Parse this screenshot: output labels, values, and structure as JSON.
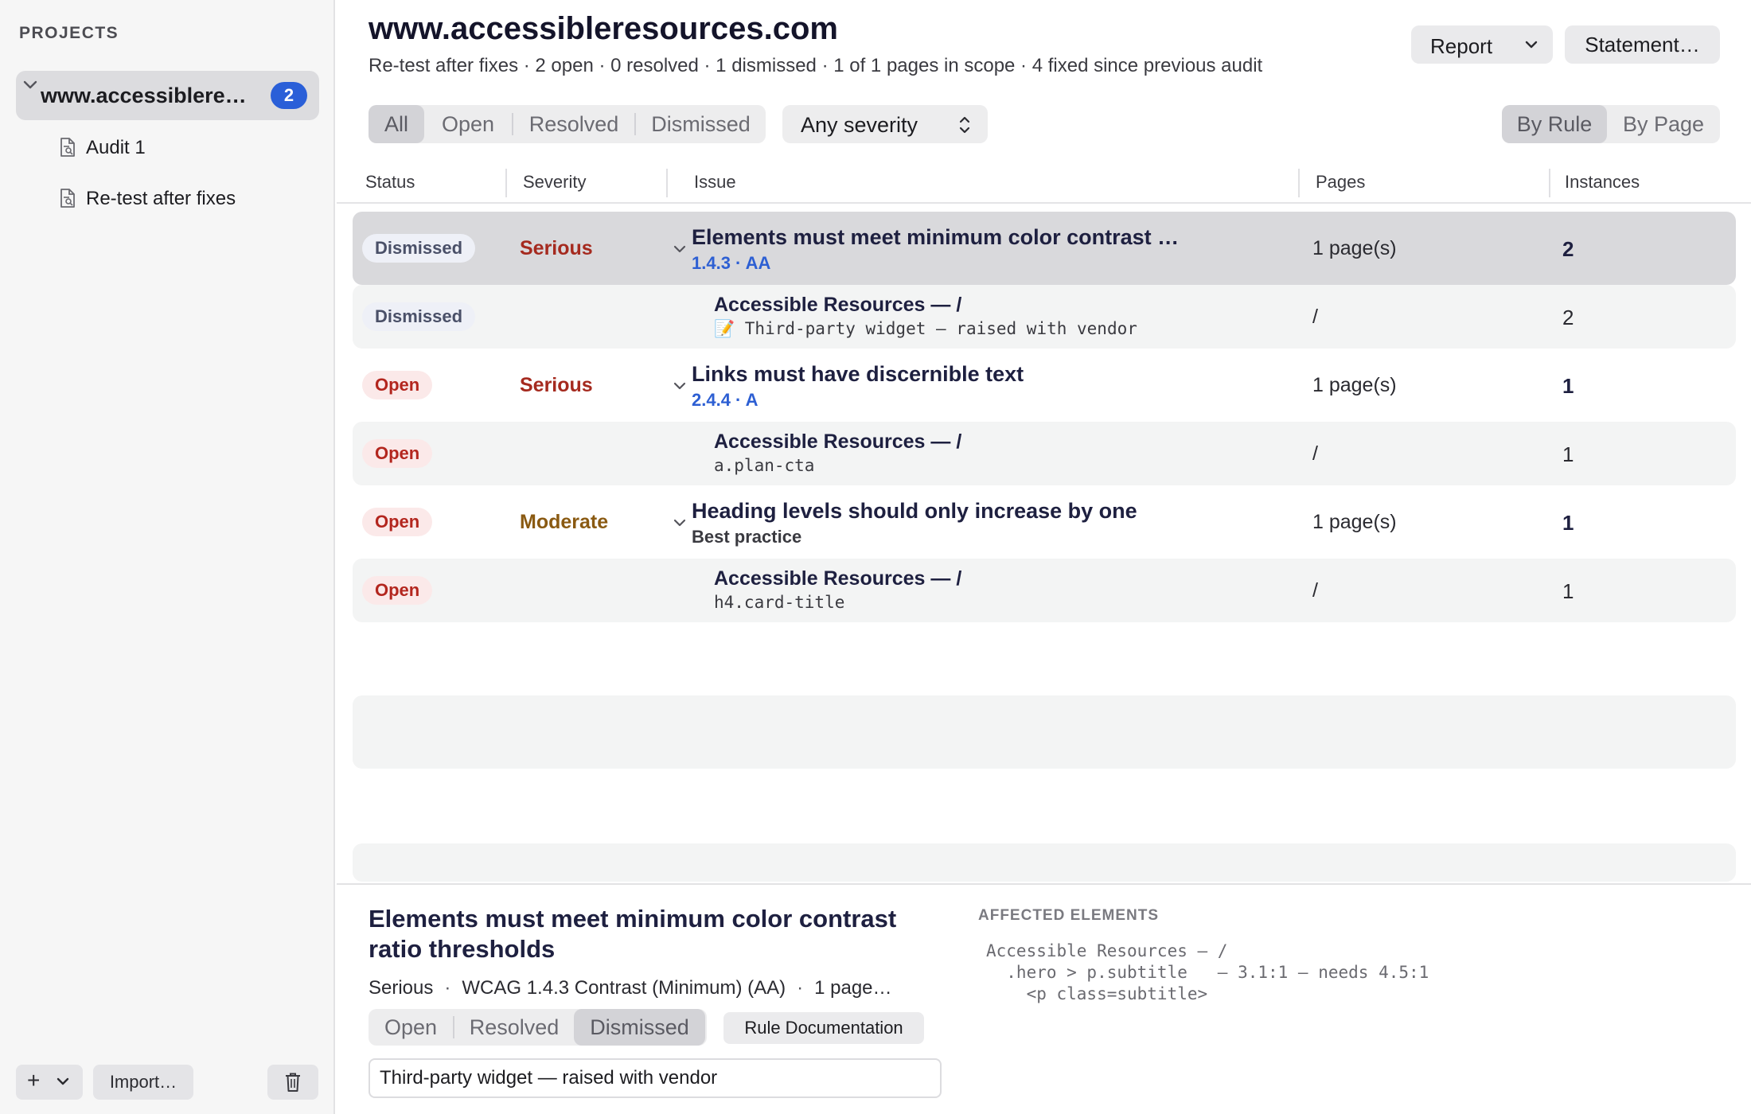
{
  "sidebar": {
    "heading": "PROJECTS",
    "project": {
      "name": "www.accessiblere…",
      "badge": "2"
    },
    "audits": [
      {
        "label": "Audit 1"
      },
      {
        "label": "Re-test after fixes"
      }
    ],
    "footer": {
      "add_label": "+",
      "import_label": "Import…"
    }
  },
  "header": {
    "title": "www.accessibleresources.com",
    "subtitle": "Re-test after fixes · 2 open · 0 resolved · 1 dismissed · 1 of 1 pages in scope · 4 fixed since previous audit",
    "report_label": "Report",
    "statement_label": "Statement…"
  },
  "filters": {
    "status": [
      {
        "label": "All",
        "active": true
      },
      {
        "label": "Open",
        "active": false
      },
      {
        "label": "Resolved",
        "active": false
      },
      {
        "label": "Dismissed",
        "active": false
      }
    ],
    "severity_selected": "Any severity",
    "view": [
      {
        "label": "By Rule",
        "active": true
      },
      {
        "label": "By Page",
        "active": false
      }
    ]
  },
  "table": {
    "columns": [
      "Status",
      "Severity",
      "Issue",
      "Pages",
      "Instances"
    ],
    "rows": [
      {
        "status": "Dismissed",
        "severity": "Serious",
        "title": "Elements must meet minimum color contrast ratio thresholds",
        "sub": "1.4.3 · AA",
        "pages": "1 page(s)",
        "instances": "2",
        "child": {
          "status": "Dismissed",
          "title": "Accessible Resources — /",
          "sub": "📝 Third‑party widget — raised with vendor",
          "pages": "/",
          "instances": "2"
        }
      },
      {
        "status": "Open",
        "severity": "Serious",
        "title": "Links must have discernible text",
        "sub": "2.4.4 · A",
        "pages": "1 page(s)",
        "instances": "1",
        "child": {
          "status": "Open",
          "title": "Accessible Resources — /",
          "sub": "a.plan-cta",
          "pages": "/",
          "instances": "1"
        }
      },
      {
        "status": "Open",
        "severity": "Moderate",
        "title": "Heading levels should only increase by one",
        "sub": "Best practice",
        "pages": "1 page(s)",
        "instances": "1",
        "child": {
          "status": "Open",
          "title": "Accessible Resources — /",
          "sub": "h4.card-title",
          "pages": "/",
          "instances": "1"
        }
      }
    ]
  },
  "detail": {
    "title": "Elements must meet minimum color contrast ratio thresholds",
    "severity": "Serious",
    "wcag": "WCAG 1.4.3 Contrast (Minimum) (AA)",
    "pages": "1 page…",
    "status_options": [
      {
        "label": "Open",
        "active": false
      },
      {
        "label": "Resolved",
        "active": false
      },
      {
        "label": "Dismissed",
        "active": true
      }
    ],
    "rule_doc_label": "Rule Documentation",
    "note": "Third-party widget — raised with vendor",
    "affected_heading": "AFFECTED ELEMENTS",
    "affected_lines": [
      "Accessible Resources — /",
      "  .hero > p.subtitle   — 3.1:1 — needs 4.5:1",
      "    <p class=subtitle>"
    ]
  },
  "colors": {
    "accent": "#2a5fd8",
    "serious": "#a52a1f",
    "moderate": "#8a5a12",
    "open_pill_bg": "#fbe9e9",
    "dismissed_pill_bg": "#eef0f7"
  },
  "icons": {
    "project_chevron": "chevron-down-icon",
    "audit_doc": "document-search-icon",
    "trash": "trash-icon",
    "severity_select": "up-down-chevron-icon"
  }
}
